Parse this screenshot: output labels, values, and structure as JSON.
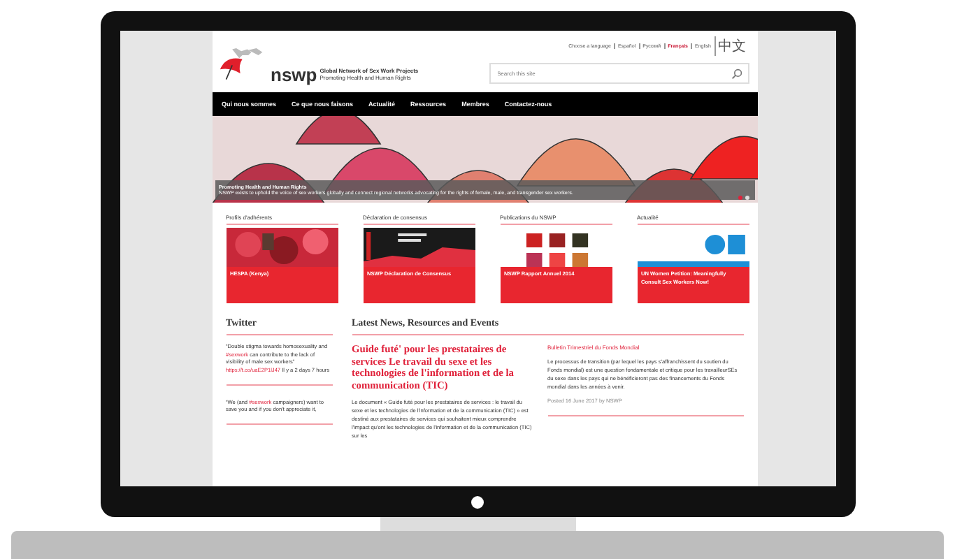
{
  "language_bar": {
    "label": "Choose a language",
    "languages": [
      {
        "label": "Español",
        "selected": false
      },
      {
        "label": "Русский",
        "selected": false
      },
      {
        "label": "Français",
        "selected": true
      },
      {
        "label": "English",
        "selected": false
      },
      {
        "label": "中文",
        "selected": false
      }
    ]
  },
  "logo": {
    "wordmark": "nswp",
    "name": "Global Network of Sex Work Projects",
    "tagline": "Promoting Health and Human Rights"
  },
  "search": {
    "placeholder": "Search this site"
  },
  "nav": [
    "Qui nous sommes",
    "Ce que nous faisons",
    "Actualité",
    "Ressources",
    "Membres",
    "Contactez-nous"
  ],
  "banner": {
    "title": "Promoting Health and Human Rights",
    "text": "NSWP exists to uphold the voice of sex workers globally and connect regional networks advocating for the rights of female, male, and transgender sex workers.",
    "slides": [
      {
        "selected": true
      },
      {
        "selected": false
      }
    ]
  },
  "features": [
    {
      "heading": "Profils d'adhérents",
      "caption": "HESPA (Kenya)"
    },
    {
      "heading": "Déclaration de consensus",
      "caption": "NSWP Déclaration de Consensus",
      "kind": "cover"
    },
    {
      "heading": "Publications du NSWP",
      "caption": "NSWP Rapport Annuel 2014",
      "kind": "thumbs"
    },
    {
      "heading": "Actualité",
      "caption": "UN Women Petition: Meaningfully Consult Sex Workers Now!",
      "kind": "logo"
    }
  ],
  "twitter": {
    "heading": "Twitter",
    "tweets": [
      {
        "parts": [
          {
            "kind": "plain",
            "text": "“Double stigma towards homosexuality and "
          },
          {
            "kind": "link",
            "text": "#sexwork"
          },
          {
            "kind": "plain",
            "text": " can contribute to the lack of visibility of male sex workers” "
          },
          {
            "kind": "link",
            "text": "https://t.co/uaE2P1lJ47"
          },
          {
            "kind": "plain",
            "text": " Il y a 2 days 7 hours"
          }
        ]
      },
      {
        "parts": [
          {
            "kind": "plain",
            "text": "“We (and "
          },
          {
            "kind": "link",
            "text": "#sexwork"
          },
          {
            "kind": "plain",
            "text": " campaigners) want to save you and if you don't appreciate it,"
          }
        ]
      }
    ]
  },
  "latest": {
    "heading": "Latest News, Resources and Events",
    "article": {
      "title": "Guide futé' pour les prestataires de services Le travail du sexe et les technologies de l'information et de la communication (TIC)",
      "body": "Le document « Guide futé pour les prestataires de services : le travail du sexe et les technologies de l'information et de la communication (TIC) » est destiné aux prestataires de services qui souhaitent mieux comprendre l'impact qu'ont les technologies de l'information et de la communication (TIC) sur les"
    },
    "bulletin": {
      "title": "Bulletin Trimestriel du Fonds Mondial",
      "body": "Le processus de transition (par lequel les pays s'affranchissent du soutien du Fonds mondial) est une question fondamentale et critique pour les travailleurSEs du sexe dans les pays qui ne bénéficieront pas des financements du Fonds mondial dans les années à venir.",
      "meta": "Posted 16 June 2017 by NSWP"
    }
  }
}
